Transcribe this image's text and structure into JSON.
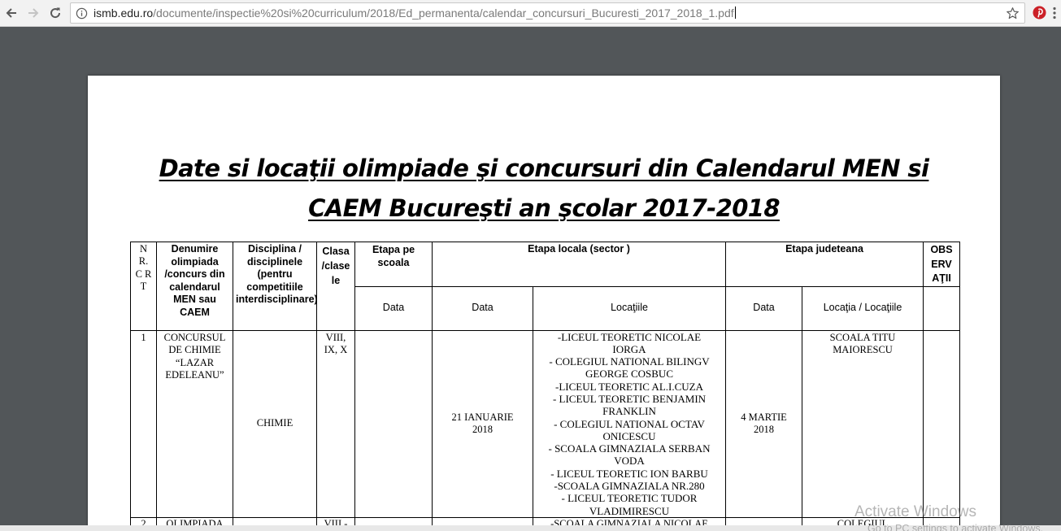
{
  "browser": {
    "url_host": "ismb.edu.ro",
    "url_path": "/documente/inspectie%20si%20curriculum/2018/Ed_permanenta/calendar_concursuri_Bucuresti_2017_2018_1.pdf"
  },
  "document": {
    "title_line1": "Date si locaţii olimpiade şi concursuri din Calendarul MEN si",
    "title_line2": "CAEM Bucureşti an şcolar 2017-2018",
    "headers": {
      "nrcrt": "N R. C R T",
      "denumire": "Denumire olimpiada /concurs din calendarul MEN sau CAEM",
      "disciplina": "Disciplina / disciplinele (pentru competitiile interdisciplinare)",
      "clasa": "Clasa /clasele",
      "etapa_scoala": "Etapa pe scoala",
      "etapa_locala": "Etapa locala (sector )",
      "etapa_judeteana": "Etapa judeteana",
      "observatii": "OBSERVAŢII",
      "data_scoala": "Data",
      "data_locala": "Data",
      "locatiile": "Locaţiile",
      "data_judeteana": "Data",
      "locatia_judeteana": "Locaţia / Locaţiile"
    },
    "rows": [
      {
        "nr": "1",
        "denumire": "CONCURSUL DE CHIMIE “LAZAR EDELEANU”",
        "disciplina": "CHIMIE",
        "clasa": "VIII, IX, X",
        "data_scoala": "",
        "data_locala": "21 IANUARIE 2018",
        "locatii": [
          "-LICEUL TEORETIC NICOLAE IORGA",
          "- COLEGIUL NATIONAL BILINGV GEORGE COSBUC",
          "-LICEUL TEORETIC AL.I.CUZA",
          "- LICEUL TEORETIC BENJAMIN FRANKLIN",
          "- COLEGIUL NATIONAL OCTAV ONICESCU",
          "- SCOALA GIMNAZIALA SERBAN VODA",
          "- LICEUL TEORETIC ION BARBU",
          "-SCOALA GIMNAZIALA NR.280",
          "- LICEUL TEORETIC TUDOR VLADIMIRESCU"
        ],
        "data_judeteana": "4 MARTIE 2018",
        "locatia_judeteana": "SCOALA TITU MAIORESCU",
        "observatii": ""
      },
      {
        "nr": "2",
        "denumire": "OLIMPIADA",
        "clasa": "VIII -",
        "locatie_partial": "-SCOALA GIMNAZIALA NICOLAE",
        "locatia_judeteana_partial": "COLEGIUL"
      }
    ]
  },
  "watermark": {
    "line1": "Activate Windows",
    "line2": "Go to PC settings to activate Windows."
  }
}
